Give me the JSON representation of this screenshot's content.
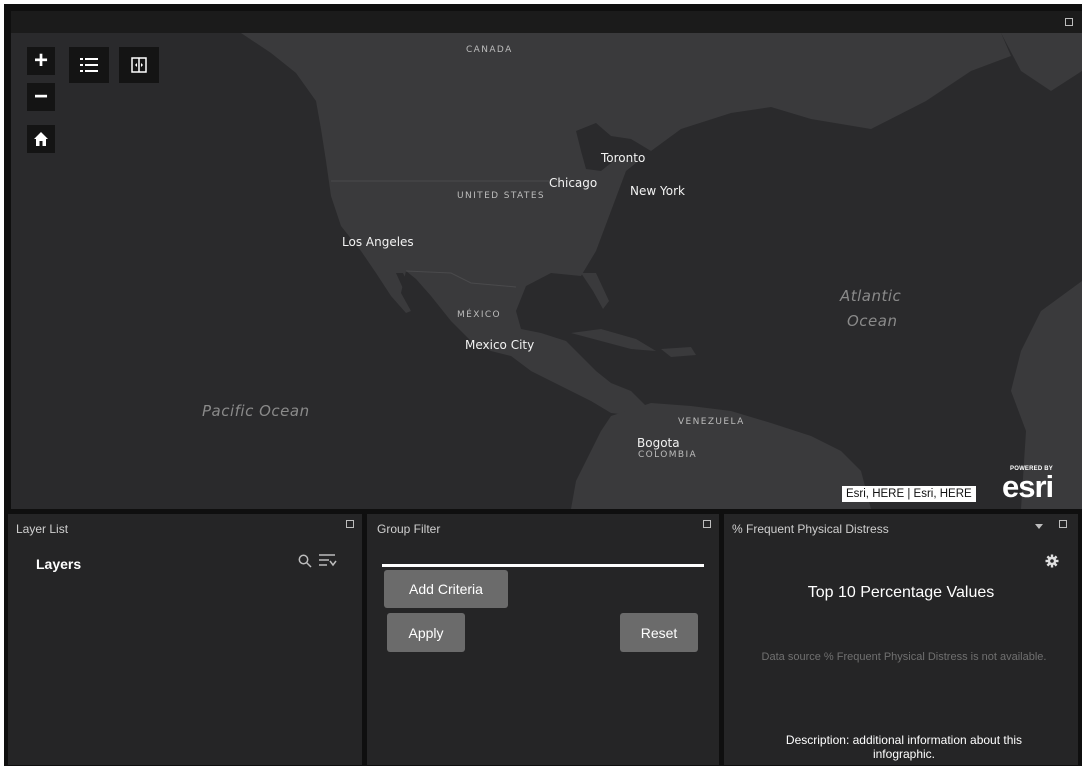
{
  "map": {
    "zoom_in": "+",
    "zoom_out": "−",
    "labels": {
      "canada": "CANADA",
      "united_states": "UNITED STATES",
      "mexico": "MÉXICO",
      "venezuela": "VENEZUELA",
      "colombia": "COLOMBIA",
      "toronto": "Toronto",
      "chicago": "Chicago",
      "new_york": "New York",
      "los_angeles": "Los Angeles",
      "mexico_city": "Mexico City",
      "bogota": "Bogota",
      "pacific_ocean": "Pacific Ocean",
      "atlantic": "Atlantic",
      "ocean": "Ocean"
    },
    "attribution": "Esri, HERE | Esri, HERE",
    "esri_powered": "POWERED BY",
    "esri_logo": "esri"
  },
  "layer_list": {
    "title": "Layer List",
    "heading": "Layers"
  },
  "group_filter": {
    "title": "Group Filter",
    "add_criteria": "Add Criteria",
    "apply": "Apply",
    "reset": "Reset"
  },
  "infographic": {
    "title": "% Frequent Physical Distress",
    "chart_title": "Top 10 Percentage Values",
    "message": "Data source % Frequent Physical Distress is not available.",
    "description": "Description: additional information about this infographic."
  },
  "colors": {
    "land": "#3a3a3c",
    "water": "#2a2a2c",
    "panel": "#252526",
    "button": "#6b6b6b"
  }
}
